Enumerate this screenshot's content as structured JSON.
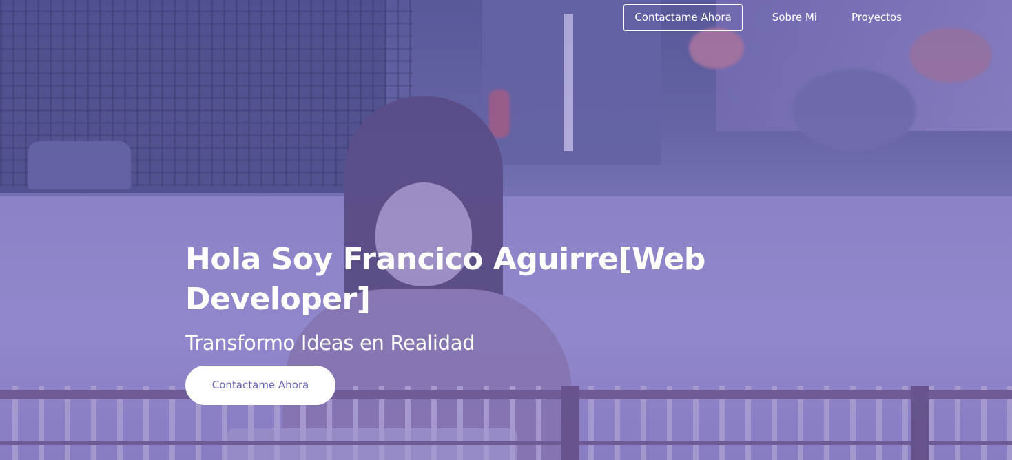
{
  "nav": {
    "cta_label": "Contactame Ahora",
    "about_label": "Sobre Mi",
    "projects_label": "Proyectos"
  },
  "hero": {
    "title": "Hola Soy Francico Aguirre[Web Developer]",
    "subtitle": "Transformo Ideas en Realidad",
    "cta_label": "Contactame Ahora"
  },
  "colors": {
    "overlay": "#7066be",
    "text": "#ffffff",
    "button_bg": "#ffffff",
    "button_text": "#6a67b8"
  }
}
